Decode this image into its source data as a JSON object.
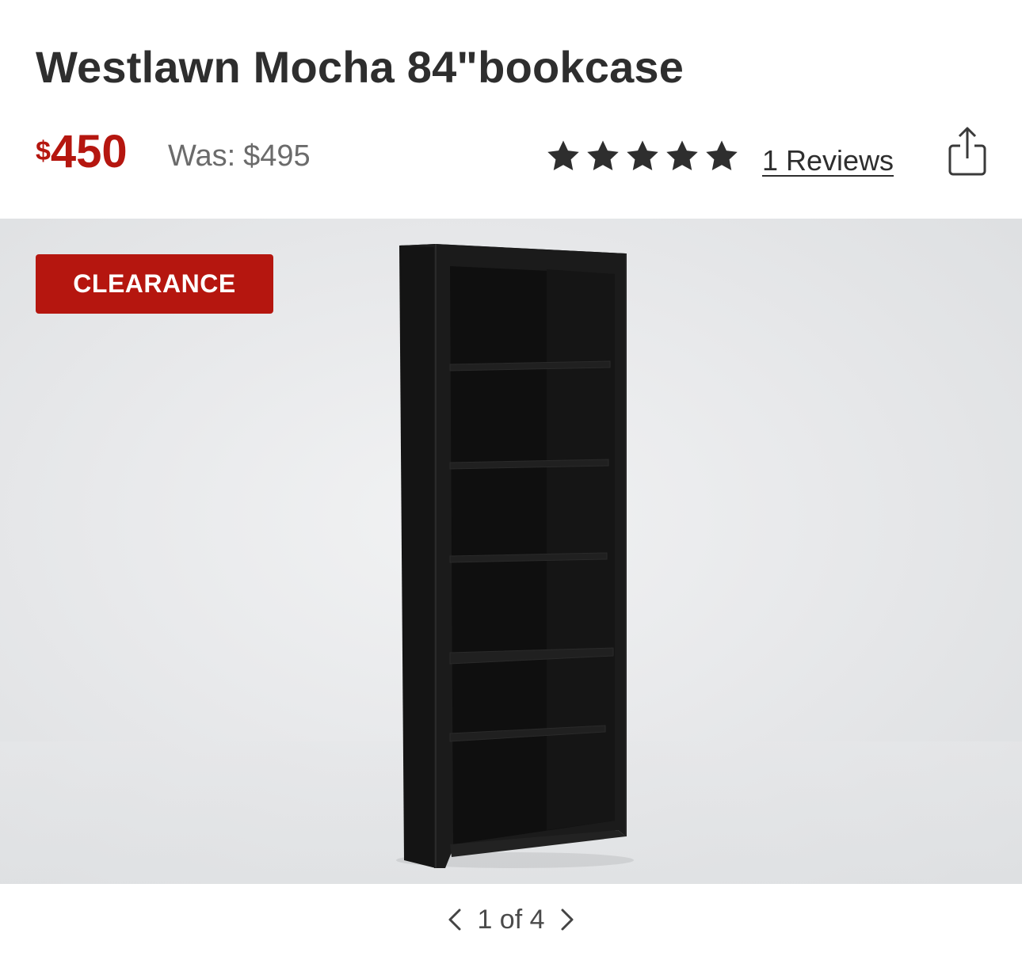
{
  "product": {
    "title": "Westlawn Mocha 84\"bookcase",
    "price_currency": "$",
    "price_amount": "450",
    "was_label": "Was:",
    "was_price": "$495",
    "rating": 5,
    "reviews_label": "1 Reviews"
  },
  "gallery": {
    "badge": "CLEARANCE",
    "image_subject": "black bookcase",
    "page_indicator": "1 of 4",
    "current_page": 1,
    "total_pages": 4
  },
  "icons": {
    "star": "star-icon",
    "share": "share-icon",
    "prev": "chevron-left-icon",
    "next": "chevron-right-icon"
  },
  "colors": {
    "accent": "#b5160f",
    "text": "#2e2e2e",
    "muted": "#6b6b6b"
  }
}
